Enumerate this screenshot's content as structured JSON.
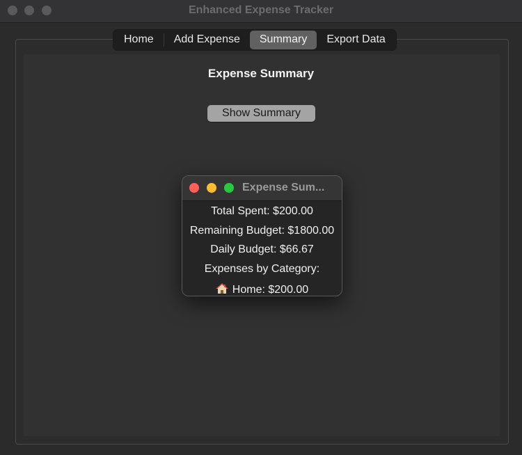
{
  "window": {
    "title": "Enhanced Expense Tracker"
  },
  "tabs": [
    {
      "label": "Home"
    },
    {
      "label": "Add Expense"
    },
    {
      "label": "Summary"
    },
    {
      "label": "Export Data"
    }
  ],
  "summary_page": {
    "heading": "Expense Summary",
    "show_button_label": "Show Summary"
  },
  "popup": {
    "title": "Expense Sum...",
    "total_spent": "Total Spent: $200.00",
    "remaining_budget": "Remaining Budget: $1800.00",
    "daily_budget": "Daily Budget: $66.67",
    "category_header": "Expenses by Category:",
    "category_home": "Home: $200.00",
    "category_icon": "house-icon"
  },
  "colors": {
    "traffic_red": "#ff5f57",
    "traffic_yellow": "#febc2e",
    "traffic_green": "#28c840",
    "selected_tab": "#616161"
  }
}
